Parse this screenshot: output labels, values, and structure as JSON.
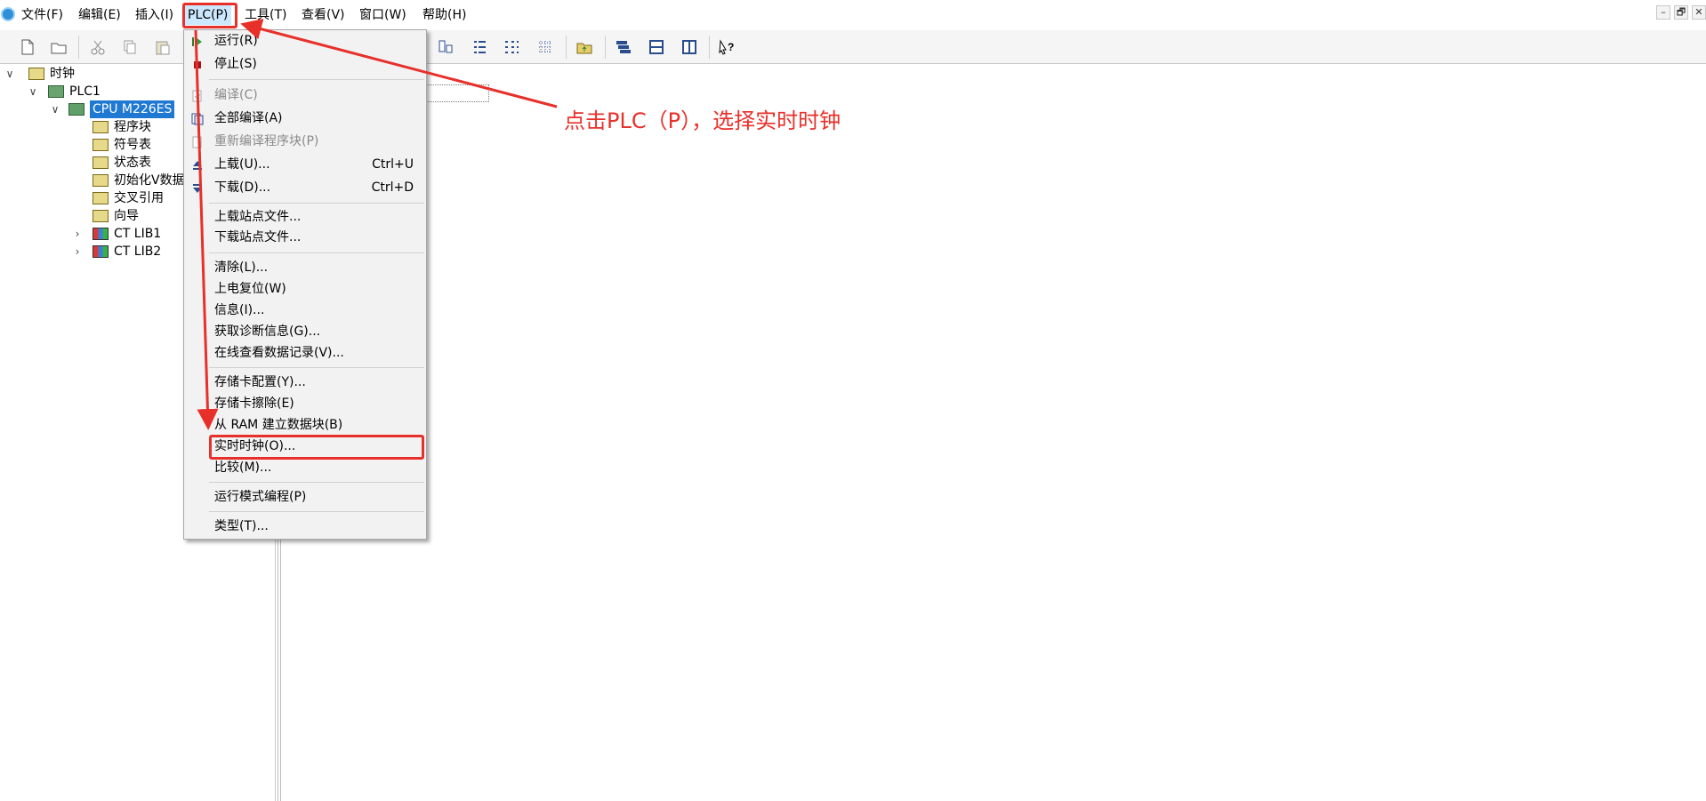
{
  "menubar": {
    "items": [
      {
        "label": "文件(F)"
      },
      {
        "label": "编辑(E)"
      },
      {
        "label": "插入(I)"
      },
      {
        "label": "PLC(P)"
      },
      {
        "label": "工具(T)"
      },
      {
        "label": "查看(V)"
      },
      {
        "label": "窗口(W)"
      },
      {
        "label": "帮助(H)"
      }
    ],
    "window_controls": [
      "–",
      "🗗",
      "✕"
    ]
  },
  "toolbar": {
    "icons": [
      "new-file-icon",
      "open-folder-icon",
      "cut-icon",
      "copy-icon",
      "paste-icon",
      "ladder-contact-icon",
      "list-tree-icon",
      "list-indent-icon",
      "grid-icon",
      "folder-up-icon",
      "stack-icon",
      "split-horizontal-icon",
      "split-vertical-icon",
      "context-help-icon"
    ]
  },
  "tree": {
    "root": "时钟",
    "plc": "PLC1",
    "cpu": "CPU M226ES",
    "children": [
      "程序块",
      "符号表",
      "状态表",
      "初始化V数据",
      "交叉引用",
      "向导"
    ],
    "libs": [
      "CT LIB1",
      "CT LIB2"
    ]
  },
  "dropdown": {
    "items": [
      {
        "label": "运行(R)",
        "shortcut": "",
        "disabled": false
      },
      {
        "label": "停止(S)",
        "shortcut": "",
        "disabled": false
      },
      {
        "label": "编译(C)",
        "shortcut": "",
        "disabled": true
      },
      {
        "label": "全部编译(A)",
        "shortcut": "",
        "disabled": false
      },
      {
        "label": "重新编译程序块(P)",
        "shortcut": "",
        "disabled": true
      },
      {
        "label": "上载(U)...",
        "shortcut": "Ctrl+U",
        "disabled": false
      },
      {
        "label": "下载(D)...",
        "shortcut": "Ctrl+D",
        "disabled": false
      },
      {
        "label": "上载站点文件...",
        "shortcut": "",
        "disabled": false
      },
      {
        "label": "下载站点文件...",
        "shortcut": "",
        "disabled": false
      },
      {
        "label": "清除(L)...",
        "shortcut": "",
        "disabled": false
      },
      {
        "label": "上电复位(W)",
        "shortcut": "",
        "disabled": false
      },
      {
        "label": "信息(I)...",
        "shortcut": "",
        "disabled": false
      },
      {
        "label": "获取诊断信息(G)...",
        "shortcut": "",
        "disabled": false
      },
      {
        "label": "在线查看数据记录(V)...",
        "shortcut": "",
        "disabled": false
      },
      {
        "label": "存储卡配置(Y)...",
        "shortcut": "",
        "disabled": false
      },
      {
        "label": "存储卡擦除(E)",
        "shortcut": "",
        "disabled": false
      },
      {
        "label": "从 RAM 建立数据块(B)",
        "shortcut": "",
        "disabled": false
      },
      {
        "label": "实时时钟(O)...",
        "shortcut": "",
        "disabled": false
      },
      {
        "label": "比较(M)...",
        "shortcut": "",
        "disabled": false
      },
      {
        "label": "运行模式编程(P)",
        "shortcut": "",
        "disabled": false
      },
      {
        "label": "类型(T)...",
        "shortcut": "",
        "disabled": false
      }
    ]
  },
  "annotation": {
    "text": "点击PLC（P），选择实时时钟",
    "color": "#e8302a"
  },
  "colors": {
    "accent": "#e8302a",
    "selection": "#1f78d1",
    "menu_active": "#cce8ff"
  }
}
